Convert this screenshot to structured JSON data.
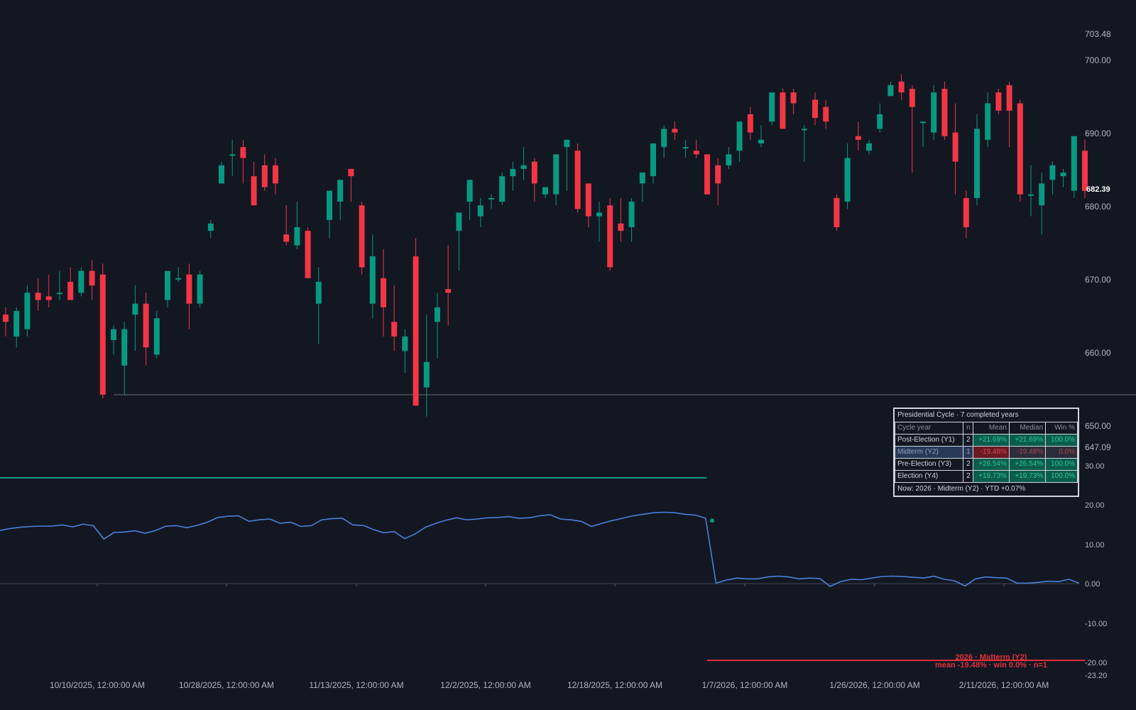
{
  "price_axis": {
    "labels": [
      "703.48",
      "700.00",
      "690.00",
      "680.00",
      "670.00",
      "660.00",
      "650.00",
      "647.09"
    ],
    "last_price": "682.39"
  },
  "indicator_axis": {
    "labels": [
      "30.00",
      "20.00",
      "10.00",
      "0.00",
      "-10.00",
      "-20.00",
      "-23.20"
    ]
  },
  "time_axis": {
    "labels": [
      "10/10/2025, 12:00:00 AM",
      "10/28/2025, 12:00:00 AM",
      "11/13/2025, 12:00:00 AM",
      "12/2/2025, 12:00:00 AM",
      "12/18/2025, 12:00:00 AM",
      "1/7/2026, 12:00:00 AM",
      "1/26/2026, 12:00:00 AM",
      "2/11/2026, 12:00:00 AM"
    ]
  },
  "colors": {
    "background": "#131722",
    "up": "#089981",
    "down": "#f23645",
    "indicator_line": "#4a80d9",
    "mean_line_green": "#089981",
    "mean_line_red": "#e0323e",
    "table_border": "#d1d4dc"
  },
  "annotation": {
    "line1": "2026 · Midterm (Y2)",
    "line2": "mean -19.48% · win 0.0% · n=1"
  },
  "cycle_table": {
    "title": "Presidential Cycle · 7 completed years",
    "headers": [
      "Cycle year",
      "n",
      "Mean",
      "Median",
      "Win %"
    ],
    "rows": [
      {
        "name": "Post-Election (Y1)",
        "n": "2",
        "mean": "+21.69%",
        "median": "+21.69%",
        "win": "100.0%",
        "tone": "pos",
        "highlight": false
      },
      {
        "name": "Midterm (Y2)",
        "n": "1",
        "mean": "-19.48%",
        "median": "-19.48%",
        "win": "0.0%",
        "tone": "neg",
        "highlight": true
      },
      {
        "name": "Pre-Election (Y3)",
        "n": "2",
        "mean": "+26.54%",
        "median": "+26.54%",
        "win": "100.0%",
        "tone": "pos",
        "highlight": false
      },
      {
        "name": "Election (Y4)",
        "n": "2",
        "mean": "+19.73%",
        "median": "+19.73%",
        "win": "100.0%",
        "tone": "pos",
        "highlight": false
      }
    ],
    "footer": "Now: 2026 · Midterm (Y2) · YTD +0.07%"
  },
  "chart_data": {
    "type": "candlestick",
    "price_range": [
      647.09,
      703.48
    ],
    "indicator_range": [
      -23.2,
      30
    ],
    "horizontal_level": 654.0,
    "candles": [
      [
        665.0,
        666.0,
        662.0,
        664.0
      ],
      [
        662.0,
        666.0,
        660.5,
        665.5
      ],
      [
        663.0,
        669.0,
        662.0,
        668.0
      ],
      [
        668.0,
        670.0,
        665.5,
        667.0
      ],
      [
        667.5,
        670.5,
        666.0,
        667.0
      ],
      [
        668.0,
        671.0,
        667.0,
        668.0
      ],
      [
        669.5,
        671.5,
        667.0,
        667.0
      ],
      [
        668.0,
        671.5,
        667.5,
        671.0
      ],
      [
        671.0,
        672.5,
        667.0,
        669.0
      ],
      [
        670.5,
        672.0,
        653.5,
        654.0
      ],
      [
        661.5,
        663.5,
        659.5,
        663.0
      ],
      [
        658.0,
        664.0,
        654.0,
        663.0
      ],
      [
        665.0,
        669.0,
        660.0,
        666.5
      ],
      [
        666.5,
        668.0,
        658.0,
        660.5
      ],
      [
        659.5,
        665.5,
        659.0,
        664.5
      ],
      [
        667.0,
        669.5,
        666.0,
        671.0
      ],
      [
        670.0,
        671.5,
        669.5,
        670.0
      ],
      [
        670.5,
        672.0,
        663.0,
        666.5
      ],
      [
        666.5,
        671.0,
        666.0,
        670.5
      ],
      [
        676.5,
        678.0,
        675.5,
        677.5
      ],
      [
        683.0,
        686.0,
        683.0,
        685.5
      ],
      [
        687.0,
        689.0,
        684.0,
        687.0
      ],
      [
        688.0,
        689.0,
        683.0,
        686.5
      ],
      [
        684.0,
        686.0,
        680.0,
        680.0
      ],
      [
        685.5,
        687.0,
        682.0,
        682.5
      ],
      [
        685.5,
        686.5,
        681.5,
        683.0
      ],
      [
        676.0,
        680.0,
        674.5,
        675.0
      ],
      [
        674.5,
        680.5,
        674.0,
        677.0
      ],
      [
        676.5,
        677.0,
        670.0,
        670.0
      ],
      [
        666.5,
        671.5,
        661.0,
        669.5
      ],
      [
        678.0,
        682.0,
        675.5,
        682.0
      ],
      [
        680.5,
        683.0,
        678.0,
        683.5
      ],
      [
        685.0,
        685.0,
        680.5,
        684.0
      ],
      [
        680.0,
        680.5,
        670.5,
        671.5
      ],
      [
        666.5,
        676.0,
        664.5,
        673.0
      ],
      [
        670.0,
        674.0,
        662.0,
        666.0
      ],
      [
        664.0,
        669.0,
        660.0,
        662.0
      ],
      [
        660.0,
        663.0,
        657.0,
        662.0
      ],
      [
        673.0,
        675.5,
        652.5,
        652.5
      ],
      [
        655.0,
        665.0,
        651.0,
        658.5
      ],
      [
        664.0,
        668.0,
        659.0,
        666.0
      ],
      [
        668.5,
        674.5,
        663.5,
        668.0
      ],
      [
        676.5,
        678.0,
        671.0,
        679.0
      ],
      [
        680.5,
        683.0,
        678.0,
        683.5
      ],
      [
        678.5,
        681.0,
        677.0,
        680.0
      ],
      [
        681.0,
        681.5,
        679.5,
        681.0
      ],
      [
        680.5,
        684.5,
        680.0,
        684.0
      ],
      [
        684.0,
        686.0,
        682.0,
        685.0
      ],
      [
        685.0,
        688.0,
        683.5,
        685.5
      ],
      [
        686.0,
        686.5,
        680.5,
        683.0
      ],
      [
        681.5,
        682.0,
        681.0,
        682.5
      ],
      [
        681.5,
        686.5,
        680.0,
        687.0
      ],
      [
        688.0,
        689.0,
        682.0,
        689.0
      ],
      [
        687.5,
        688.5,
        679.0,
        679.5
      ],
      [
        683.0,
        683.0,
        677.0,
        678.5
      ],
      [
        678.5,
        680.5,
        675.0,
        679.0
      ],
      [
        680.0,
        681.0,
        671.0,
        671.5
      ],
      [
        677.5,
        681.0,
        675.0,
        676.5
      ],
      [
        677.0,
        681.0,
        675.0,
        680.5
      ],
      [
        683.0,
        684.0,
        680.5,
        684.5
      ],
      [
        684.0,
        688.5,
        683.0,
        688.5
      ],
      [
        688.0,
        691.0,
        686.5,
        690.5
      ],
      [
        690.5,
        691.5,
        689.0,
        690.0
      ],
      [
        688.0,
        689.0,
        686.5,
        688.0
      ],
      [
        687.5,
        689.0,
        686.5,
        687.0
      ],
      [
        687.0,
        687.0,
        681.5,
        681.5
      ],
      [
        685.5,
        686.5,
        680.0,
        683.0
      ],
      [
        685.5,
        688.0,
        685.0,
        687.0
      ],
      [
        687.5,
        690.0,
        686.0,
        691.5
      ],
      [
        692.5,
        693.5,
        689.0,
        690.0
      ],
      [
        688.5,
        691.0,
        688.0,
        689.0
      ],
      [
        691.5,
        693.0,
        691.0,
        695.5
      ],
      [
        695.5,
        696.0,
        690.5,
        690.5
      ],
      [
        695.5,
        696.0,
        692.5,
        694.0
      ],
      [
        690.5,
        691.0,
        686.0,
        690.5
      ],
      [
        694.5,
        695.5,
        691.0,
        692.0
      ],
      [
        693.5,
        694.5,
        690.5,
        691.5
      ],
      [
        681.0,
        681.5,
        676.5,
        677.0
      ],
      [
        680.5,
        688.5,
        679.5,
        686.5
      ],
      [
        689.5,
        691.5,
        687.5,
        689.0
      ],
      [
        687.5,
        689.0,
        687.0,
        688.5
      ],
      [
        690.5,
        694.0,
        690.0,
        692.5
      ],
      [
        695.0,
        697.0,
        695.0,
        696.5
      ],
      [
        697.0,
        698.0,
        694.5,
        695.5
      ],
      [
        696.0,
        696.5,
        684.5,
        693.5
      ],
      [
        691.5,
        691.5,
        688.0,
        691.5
      ],
      [
        690.0,
        696.5,
        689.0,
        695.5
      ],
      [
        696.0,
        697.0,
        689.0,
        689.5
      ],
      [
        690.0,
        694.0,
        681.5,
        686.0
      ],
      [
        681.0,
        682.0,
        675.5,
        677.0
      ],
      [
        681.0,
        692.5,
        680.0,
        690.5
      ],
      [
        689.0,
        695.5,
        688.0,
        694.0
      ],
      [
        695.5,
        696.0,
        692.5,
        693.0
      ],
      [
        696.5,
        697.0,
        688.0,
        693.0
      ],
      [
        694.0,
        694.5,
        680.5,
        681.5
      ],
      [
        681.5,
        685.5,
        678.5,
        681.5
      ],
      [
        680.0,
        684.5,
        676.0,
        683.0
      ],
      [
        683.5,
        686.0,
        681.5,
        685.5
      ],
      [
        684.0,
        685.0,
        682.5,
        684.5
      ],
      [
        682.0,
        689.5,
        681.0,
        689.5
      ],
      [
        687.5,
        689.0,
        681.0,
        682.0
      ]
    ],
    "indicator": [
      13.5,
      14.0,
      14.3,
      14.5,
      14.6,
      14.6,
      14.9,
      14.4,
      15.1,
      14.7,
      11.3,
      13.0,
      13.1,
      13.4,
      12.8,
      13.5,
      14.6,
      14.7,
      14.2,
      14.8,
      15.6,
      16.8,
      17.1,
      17.2,
      15.8,
      16.2,
      16.4,
      15.3,
      15.6,
      14.5,
      14.7,
      16.2,
      16.5,
      16.6,
      14.9,
      14.8,
      13.7,
      12.9,
      13.2,
      11.4,
      12.6,
      14.3,
      15.3,
      16.1,
      16.7,
      16.2,
      16.4,
      16.7,
      16.8,
      17.0,
      16.6,
      16.7,
      17.2,
      17.5,
      16.4,
      16.2,
      15.8,
      14.5,
      15.3,
      16.0,
      16.6,
      17.2,
      17.6,
      18.0,
      18.1,
      18.0,
      17.6,
      17.4,
      16.6,
      0.1,
      0.9,
      1.4,
      1.2,
      1.2,
      1.7,
      1.9,
      1.7,
      1.2,
      1.4,
      1.3,
      -0.7,
      0.5,
      1.1,
      1.0,
      1.4,
      1.8,
      1.9,
      1.8,
      1.6,
      1.4,
      1.9,
      1.1,
      0.7,
      -0.6,
      1.2,
      1.7,
      1.5,
      1.4,
      0.1,
      0.1,
      0.3,
      0.6,
      0.5,
      1.1,
      0.1
    ],
    "indicator_marker": 16.0,
    "green_mean_level": 26.54,
    "red_mean_level": -19.48
  }
}
